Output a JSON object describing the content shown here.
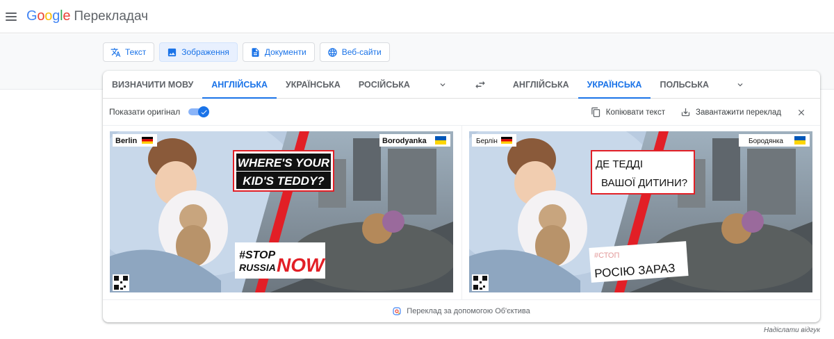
{
  "header": {
    "logo": {
      "g": "G",
      "o1": "o",
      "o2": "o",
      "g2": "g",
      "l": "l",
      "e": "e"
    },
    "product": "Перекладач"
  },
  "modes": [
    {
      "label": "Текст",
      "icon": "translate-icon",
      "active": false
    },
    {
      "label": "Зображення",
      "icon": "image-icon",
      "active": true
    },
    {
      "label": "Документи",
      "icon": "document-icon",
      "active": false
    },
    {
      "label": "Веб-сайти",
      "icon": "globe-icon",
      "active": false
    }
  ],
  "source_langs": {
    "detect": "ВИЗНАЧИТИ МОВУ",
    "items": [
      "АНГЛІЙСЬКА",
      "УКРАЇНСЬКА",
      "РОСІЙСЬКА"
    ],
    "active": "АНГЛІЙСЬКА"
  },
  "target_langs": {
    "items": [
      "АНГЛІЙСЬКА",
      "УКРАЇНСЬКА",
      "ПОЛЬСЬКА"
    ],
    "active": "УКРАЇНСЬКА"
  },
  "options": {
    "show_original": "Показати оригінал",
    "show_original_on": true,
    "copy_text": "Копіювати текст",
    "download": "Завантажити переклад"
  },
  "original_image": {
    "left_city": "Berlin",
    "right_city": "Borodyanka",
    "headline_1": "WHERE'S YOUR",
    "headline_2": "KID'S TEDDY?",
    "hashtag_1": "#STOP",
    "hashtag_2": "RUSSIA",
    "hashtag_3": "NOW"
  },
  "translated_image": {
    "left_city": "Берлін",
    "right_city": "Бородянка",
    "headline_1": "ДЕ ТЕДДІ",
    "headline_2": "ВАШОЇ ДИТИНИ?",
    "hashtag_ghost": "#СТОП",
    "hashtag": "РОСІЮ ЗАРАЗ"
  },
  "footer": {
    "lens": "Переклад за допомогою Об'єктива",
    "feedback": "Надіслати відгук"
  },
  "colors": {
    "accent": "#1a73e8",
    "poster_red": "#e21f26",
    "ua_blue": "#0057b7",
    "ua_yellow": "#ffd500"
  }
}
